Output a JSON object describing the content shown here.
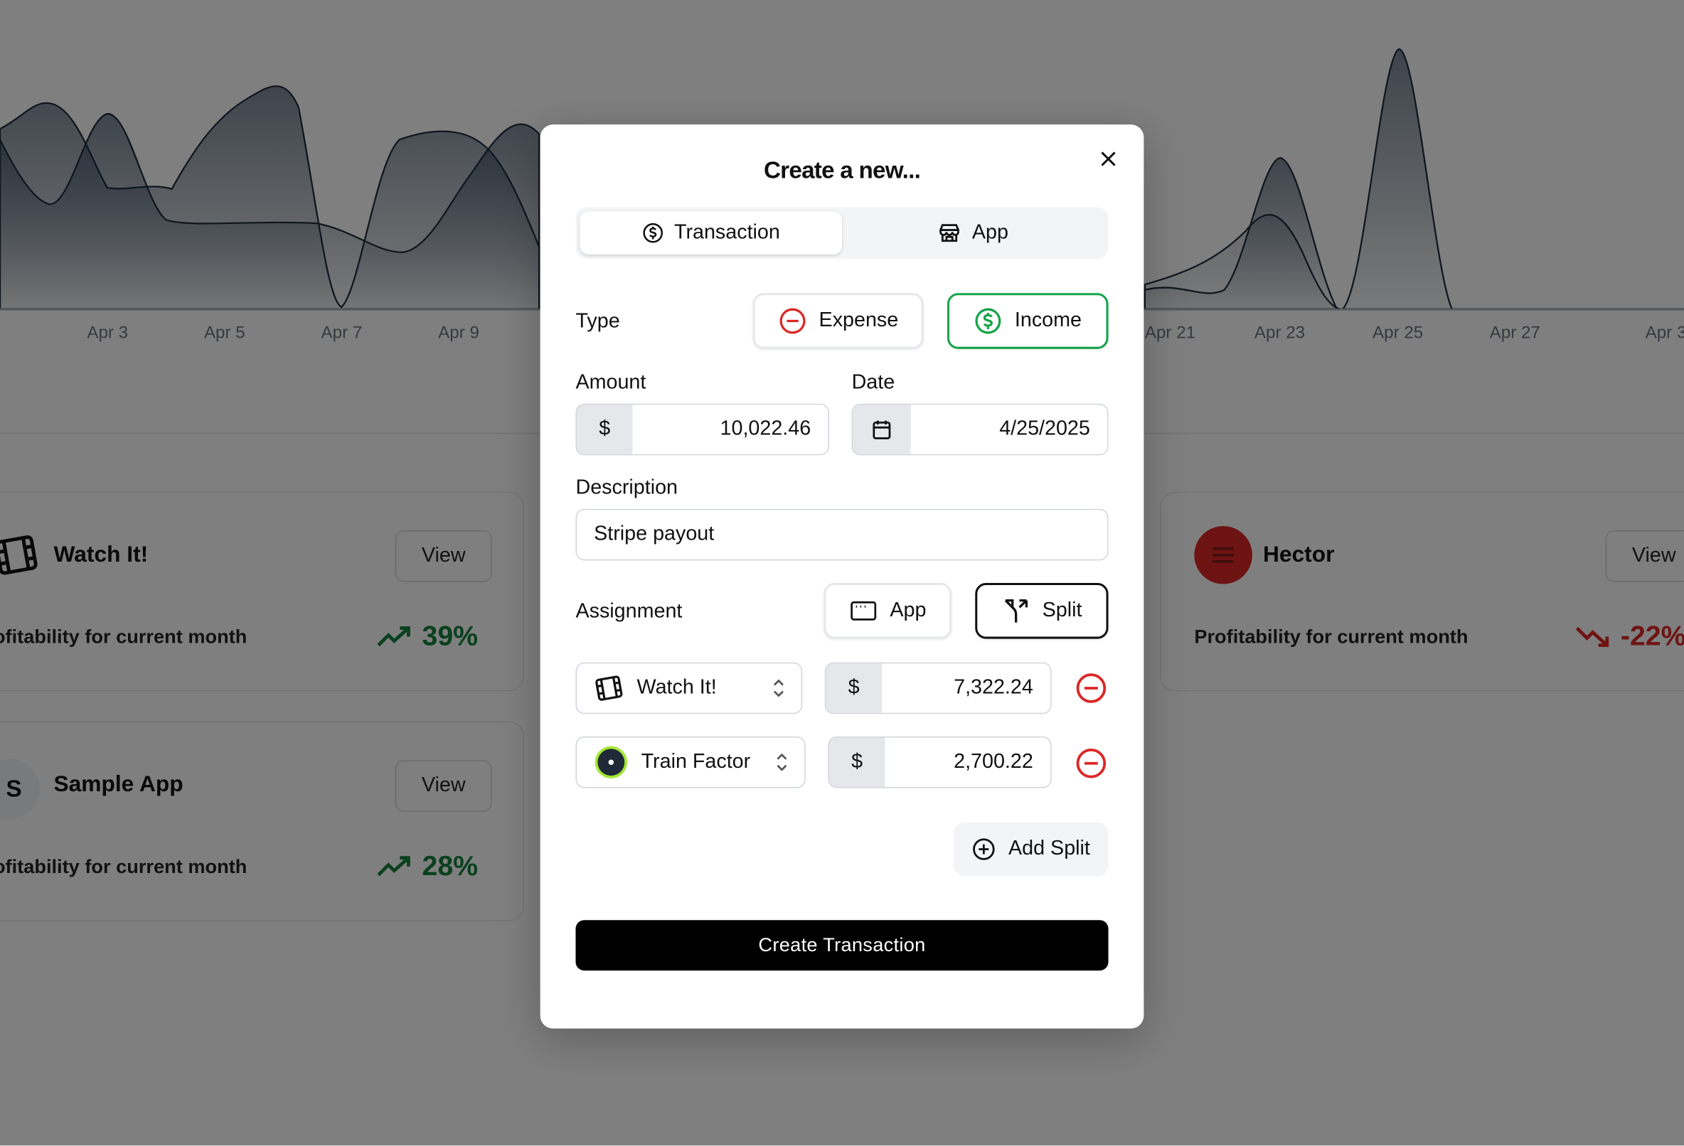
{
  "colors": {
    "income_border": "#16a34a",
    "expense_icon": "#dc2626",
    "positive": "#15803d",
    "negative": "#dc2626",
    "primary_button": "#000000",
    "overlay": "rgba(0,0,0,0.5)"
  },
  "background": {
    "chart": {
      "x_labels": [
        "Apr 3",
        "Apr 5",
        "Apr 7",
        "Apr 9",
        "Apr 21",
        "Apr 23",
        "Apr 25",
        "Apr 27",
        "Apr 3"
      ]
    },
    "cards": [
      {
        "title": "Watch It!",
        "view_label": "View",
        "subtitle": "Profitability for current month",
        "percent": "39%",
        "trend_icon": "trending-up-icon",
        "app_icon": "film-icon"
      },
      {
        "title": "Sample App",
        "avatar_letter": "S",
        "view_label": "View",
        "subtitle": "Profitability for current month",
        "percent": "28%",
        "trend_icon": "trending-up-icon"
      },
      {
        "title": "Hector",
        "view_label": "View",
        "subtitle": "Profitability for current month",
        "percent": "-22%",
        "trend_icon": "trending-down-icon",
        "app_icon": "menu-icon"
      }
    ]
  },
  "modal": {
    "title": "Create a new...",
    "close_icon": "x-icon",
    "tabs": [
      {
        "label": "Transaction",
        "icon": "dollar-circle-icon",
        "active": true
      },
      {
        "label": "App",
        "icon": "store-icon",
        "active": false
      }
    ],
    "type": {
      "label": "Type",
      "options": [
        {
          "label": "Expense",
          "icon": "minus-circle-icon",
          "selected": false
        },
        {
          "label": "Income",
          "icon": "dollar-circle-icon",
          "selected": true
        }
      ]
    },
    "amount": {
      "label": "Amount",
      "prefix": "$",
      "value": "10,022.46"
    },
    "date": {
      "label": "Date",
      "icon": "calendar-icon",
      "value": "4/25/2025"
    },
    "description": {
      "label": "Description",
      "value": "Stripe payout"
    },
    "assignment": {
      "label": "Assignment",
      "options": [
        {
          "label": "App",
          "icon": "window-icon",
          "selected": false
        },
        {
          "label": "Split",
          "icon": "split-icon",
          "selected": true
        }
      ]
    },
    "splits": [
      {
        "app": "Watch It!",
        "app_icon": "film-icon",
        "prefix": "$",
        "amount": "7,322.24"
      },
      {
        "app": "Train Factor",
        "app_icon": "train-factor-logo-icon",
        "prefix": "$",
        "amount": "2,700.22"
      }
    ],
    "add_split_label": "Add Split",
    "submit_label": "Create Transaction"
  }
}
